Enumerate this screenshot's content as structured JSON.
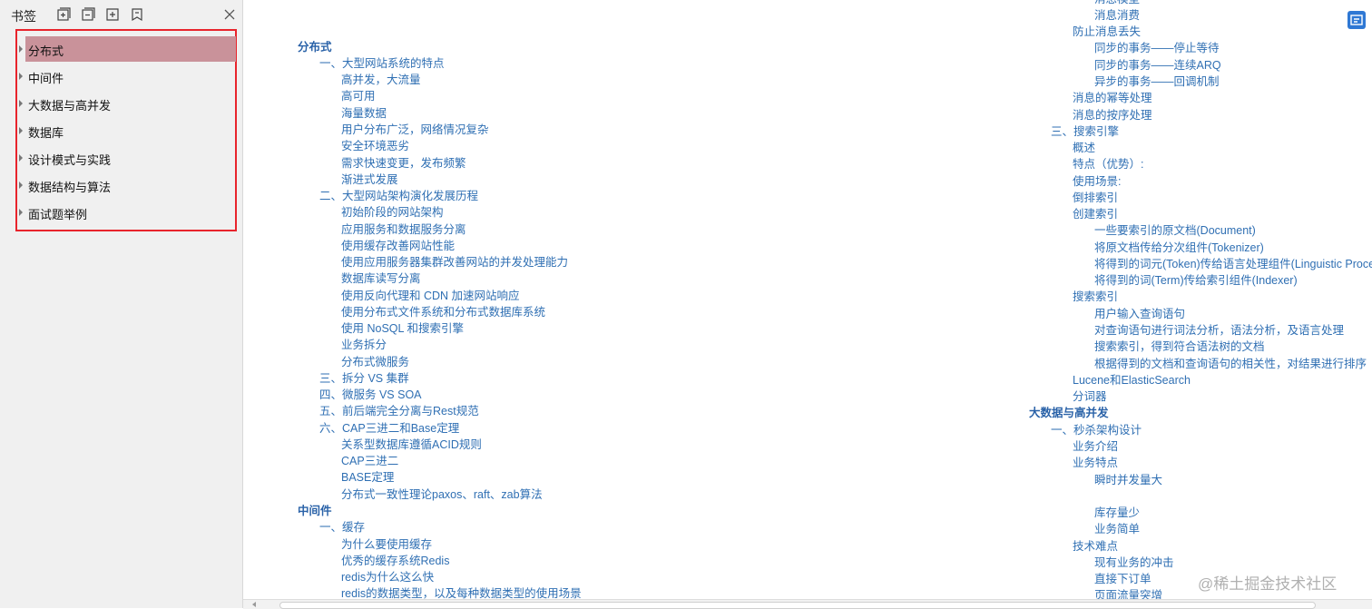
{
  "sidebar": {
    "title": "书签",
    "tools": [
      "expand-all-icon",
      "collapse-all-icon",
      "add-bookmark-icon",
      "bookmark-icon"
    ],
    "items": [
      {
        "label": "分布式",
        "selected": true
      },
      {
        "label": "中间件"
      },
      {
        "label": "大数据与高并发"
      },
      {
        "label": "数据库"
      },
      {
        "label": "设计模式与实践"
      },
      {
        "label": "数据结构与算法"
      },
      {
        "label": "面试题举例"
      }
    ]
  },
  "doc": {
    "left_column": [
      "分布式",
      "一、大型网站系统的特点",
      "高并发，大流量",
      "高可用",
      "海量数据",
      "用户分布广泛，网络情况复杂",
      "安全环境恶劣",
      "需求快速变更，发布频繁",
      "渐进式发展",
      "二、大型网站架构演化发展历程",
      "初始阶段的网站架构",
      "应用服务和数据服务分离",
      "使用缓存改善网站性能",
      "使用应用服务器集群改善网站的并发处理能力",
      "数据库读写分离",
      "使用反向代理和 CDN 加速网站响应",
      "使用分布式文件系统和分布式数据库系统",
      "使用 NoSQL 和搜索引擎",
      "业务拆分",
      "分布式微服务",
      "三、拆分 VS 集群",
      "四、微服务 VS SOA",
      "五、前后端完全分离与Rest规范",
      "六、CAP三进二和Base定理",
      "关系型数据库遵循ACID规则",
      "CAP三进二",
      "BASE定理",
      "分布式一致性理论paxos、raft、zab算法",
      "中间件",
      "一、缓存",
      "为什么要使用缓存",
      "优秀的缓存系统Redis",
      "redis为什么这么快",
      "redis的数据类型，以及每种数据类型的使用场景"
    ],
    "right_column": [
      "消息模型",
      "消息消费",
      "防止消息丢失",
      "同步的事务——停止等待",
      "同步的事务——连续ARQ",
      "异步的事务——回调机制",
      "消息的幂等处理",
      "消息的按序处理",
      "三、搜索引擎",
      "概述",
      "特点（优势）:",
      "使用场景:",
      "倒排索引",
      "创建索引",
      "一些要索引的原文档(Document)",
      "将原文档传给分次组件(Tokenizer)",
      "将得到的词元(Token)传给语言处理组件(Linguistic Processor)",
      "将得到的词(Term)传给索引组件(Indexer)",
      "搜索索引",
      "用户输入查询语句",
      "对查询语句进行词法分析，语法分析，及语言处理",
      "搜索索引，得到符合语法树的文档",
      "根据得到的文档和查询语句的相关性，对结果进行排序",
      "Lucene和ElasticSearch",
      "分词器",
      "大数据与高并发",
      "一、秒杀架构设计",
      "业务介绍",
      "业务特点",
      "瞬时并发量大",
      "库存量少",
      "业务简单",
      "技术难点",
      "现有业务的冲击",
      "直接下订单",
      "页面流量突增"
    ]
  },
  "watermark": "@稀土掘金技术社区"
}
